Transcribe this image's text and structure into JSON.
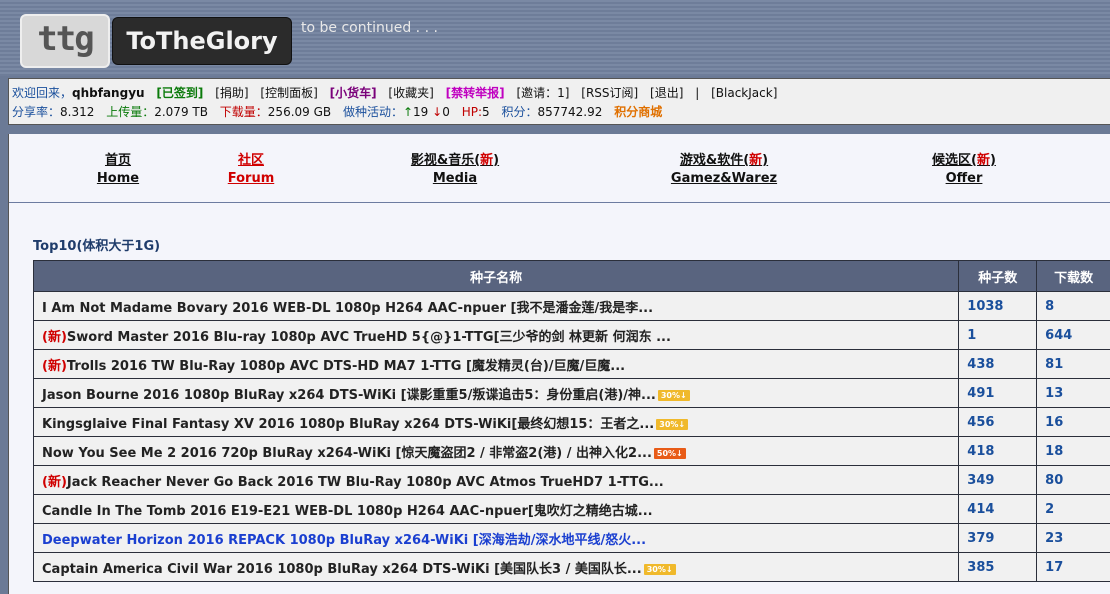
{
  "header": {
    "logo_short": "ttg",
    "logo_name": "ToTheGlory",
    "tagline": "to be continued . . ."
  },
  "userbar": {
    "welcome": "欢迎回来，",
    "username": "qhbfangyu",
    "checked_in": "[已签到]",
    "donate": "[捐助]",
    "control_panel": "[控制面板]",
    "cart": "[小货车]",
    "favorites": "[收藏夹]",
    "report": "[禁转举报]",
    "invite": "[邀请：1]",
    "rss": "[RSS订阅]",
    "logout": "[退出]",
    "divider": "|",
    "blackjack": "[BlackJack]",
    "ratio_label": "分享率：",
    "ratio_value": "8.312",
    "uploaded_label": "上传量：",
    "uploaded_value": "2.079 TB",
    "downloaded_label": "下载量：",
    "downloaded_value": "256.09 GB",
    "seeding_label": "做种活动：",
    "seeding_up_arrow": "↑",
    "seeding_up": "19",
    "seeding_down_arrow": "↓",
    "seeding_down": "0",
    "hp_label": "HP:",
    "hp_value": "5",
    "points_label": "积分：",
    "points_value": "857742.92",
    "points_shop": "积分商城"
  },
  "nav": [
    {
      "cn": "首页",
      "en": "Home",
      "new": ""
    },
    {
      "cn": "社区",
      "en": "Forum",
      "new": ""
    },
    {
      "cn": "影视&音乐(",
      "en": "Media",
      "new": "新",
      "close": ")"
    },
    {
      "cn": "游戏&软件(",
      "en": "Gamez&Warez",
      "new": "新",
      "close": ")"
    },
    {
      "cn": "候选区(",
      "en": "Offer",
      "new": "新",
      "close": ")"
    }
  ],
  "section_title": "Top10(体积大于1G)",
  "table": {
    "headers": [
      "种子名称",
      "种子数",
      "下载数"
    ],
    "rows": [
      {
        "new": "",
        "title": "I Am Not Madame Bovary 2016 WEB-DL 1080p H264 AAC-npuer [我不是潘金莲/我是李...",
        "badge": "",
        "seeders": "1038",
        "downloads": "8"
      },
      {
        "new": "(新)",
        "title": "Sword Master 2016 Blu-ray 1080p AVC TrueHD 5{@}1-TTG[三少爷的剑 林更新 何润东 ...",
        "badge": "",
        "seeders": "1",
        "downloads": "644"
      },
      {
        "new": "(新)",
        "title": "Trolls 2016 TW Blu-Ray 1080p AVC DTS-HD MA7 1-TTG [魔发精灵(台)/巨魔/巨魔...",
        "badge": "",
        "seeders": "438",
        "downloads": "81"
      },
      {
        "new": "",
        "title": "Jason Bourne 2016 1080p BluRay x264 DTS-WiKi [谍影重重5/叛谍追击5：身份重启(港)/神...",
        "badge": "30%↓",
        "seeders": "491",
        "downloads": "13"
      },
      {
        "new": "",
        "title": "Kingsglaive Final Fantasy XV 2016 1080p BluRay x264 DTS-WiKi[最终幻想15：王者之...",
        "badge": "30%↓",
        "seeders": "456",
        "downloads": "16"
      },
      {
        "new": "",
        "title": "Now You See Me 2 2016 720p BluRay x264-WiKi [惊天魔盗团2 / 非常盗2(港) / 出神入化2...",
        "badge": "50%↓",
        "seeders": "418",
        "downloads": "18"
      },
      {
        "new": "(新)",
        "title": "Jack Reacher Never Go Back 2016 TW Blu-Ray 1080p AVC Atmos TrueHD7 1-TTG...",
        "badge": "",
        "seeders": "349",
        "downloads": "80"
      },
      {
        "new": "",
        "title": "Candle In The Tomb 2016 E19-E21 WEB-DL 1080p H264 AAC-npuer[鬼吹灯之精绝古城...",
        "badge": "",
        "seeders": "414",
        "downloads": "2"
      },
      {
        "new": "",
        "title": "Deepwater Horizon 2016 REPACK 1080p BluRay x264-WiKi [深海浩劫/深水地平线/怒火...",
        "badge": "",
        "seeders": "379",
        "downloads": "23",
        "highlight": true
      },
      {
        "new": "",
        "title": "Captain America Civil War 2016 1080p BluRay x264 DTS-WiKi [美国队长3 / 美国队长...",
        "badge": "30%↓",
        "seeders": "385",
        "downloads": "17"
      }
    ]
  }
}
